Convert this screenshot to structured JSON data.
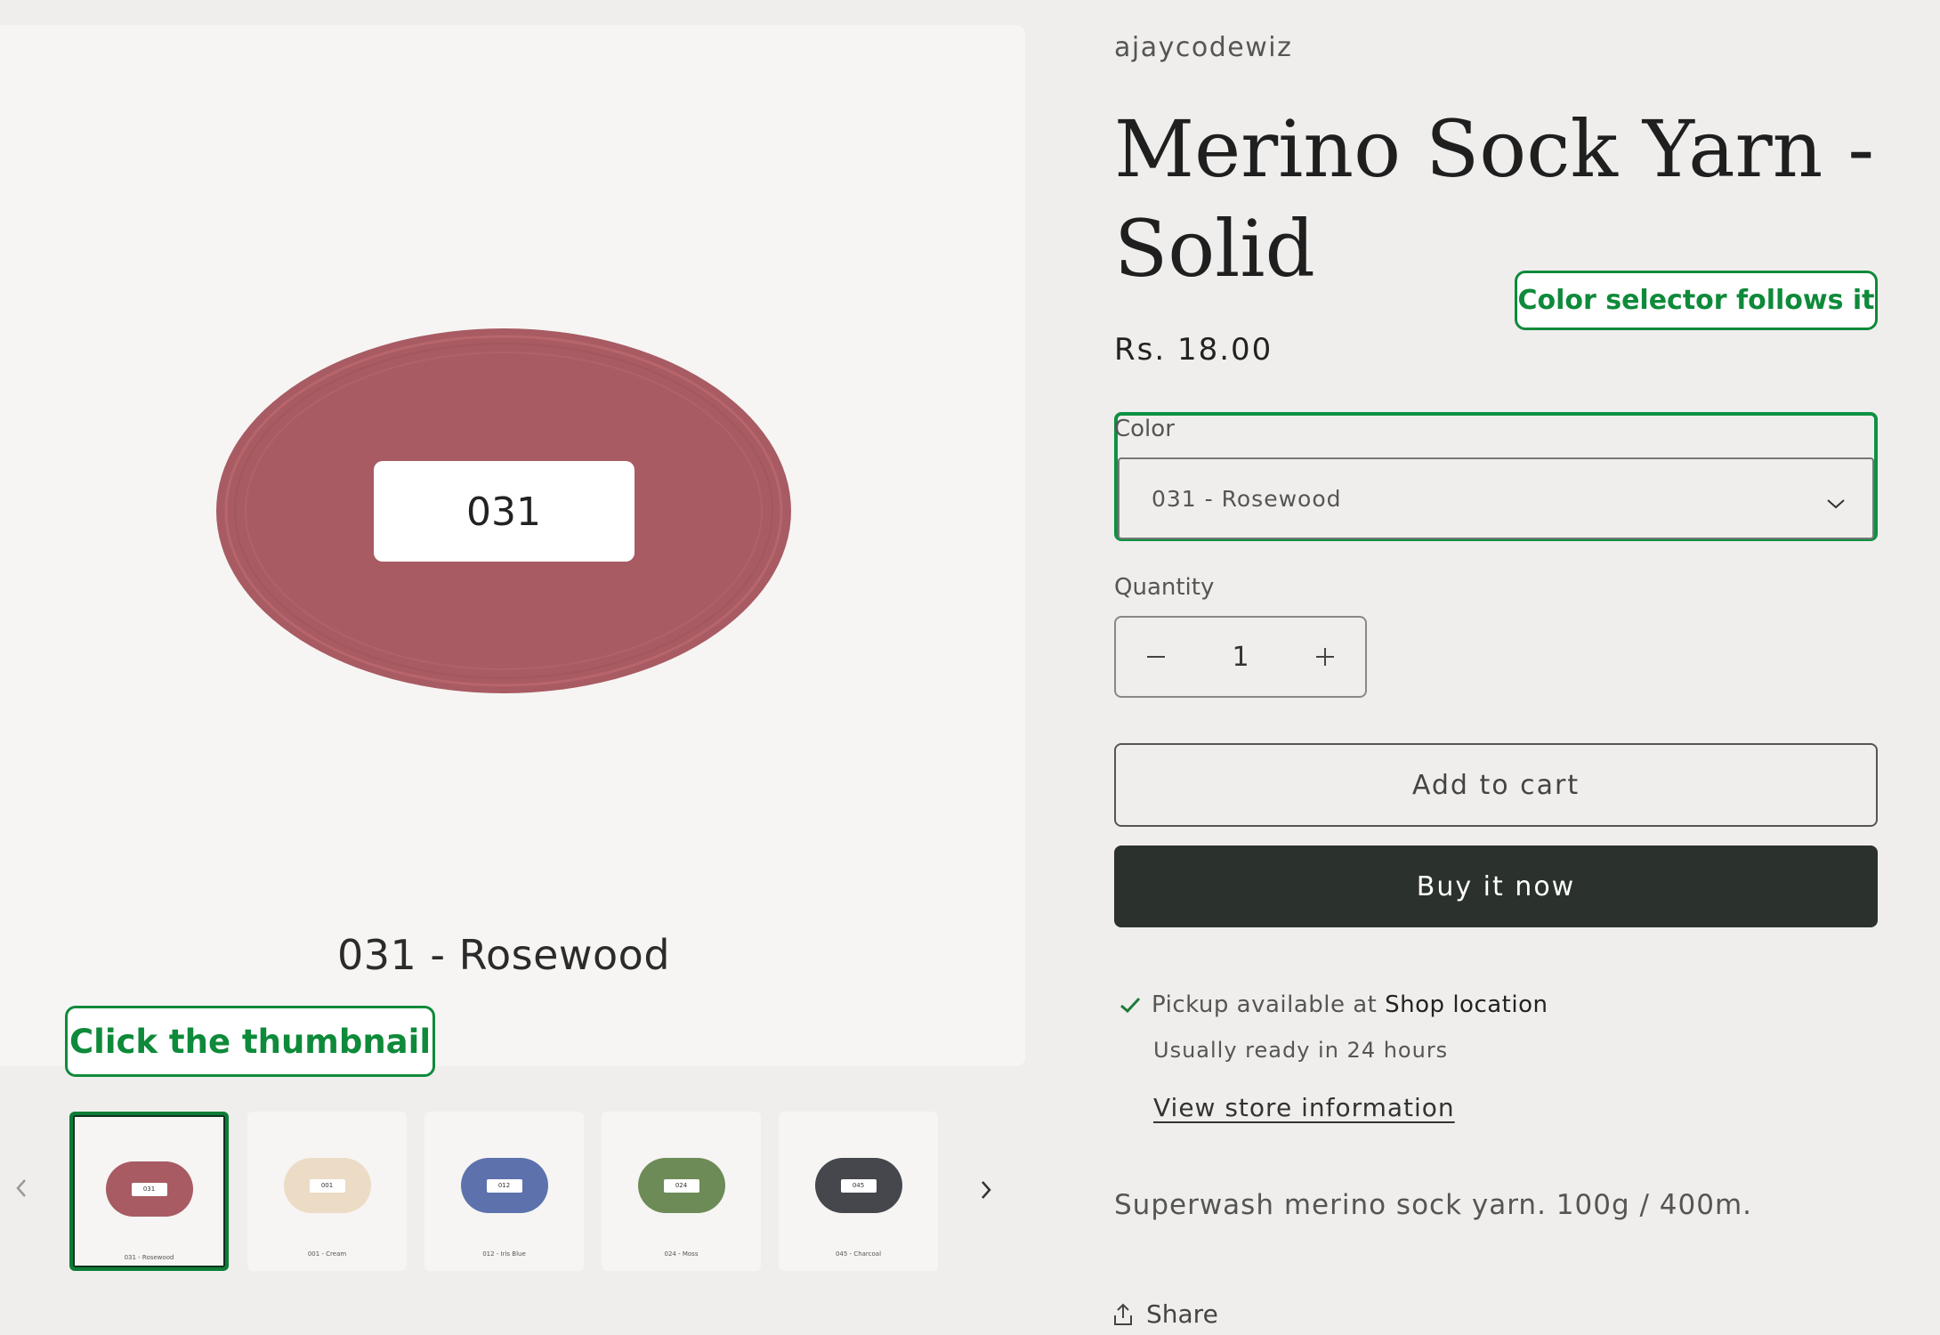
{
  "media": {
    "main_chip": "031",
    "main_caption": "031 - Rosewood",
    "main_color": "#a85b62",
    "thumbnails": [
      {
        "chip": "031",
        "label": "031 - Rosewood",
        "color": "#a85b62",
        "selected": true
      },
      {
        "chip": "001",
        "label": "001 - Cream",
        "color": "#ecdcc6",
        "selected": false
      },
      {
        "chip": "012",
        "label": "012 - Iris Blue",
        "color": "#5d72ad",
        "selected": false
      },
      {
        "chip": "024",
        "label": "024 - Moss",
        "color": "#6d8b57",
        "selected": false
      },
      {
        "chip": "045",
        "label": "045 - Charcoal",
        "color": "#45474d",
        "selected": false
      }
    ],
    "prev_icon": "chevron-left-icon",
    "next_icon": "chevron-right-icon"
  },
  "annotations": {
    "thumbnail_hint": "Click the thumbnail",
    "color_hint": "Color selector follows it"
  },
  "product": {
    "vendor": "ajaycodewiz",
    "title": "Merino Sock Yarn - Solid",
    "price": "Rs. 18.00",
    "color_label": "Color",
    "color_value": "031 - Rosewood",
    "quantity_label": "Quantity",
    "quantity_value": "1",
    "add_to_cart": "Add to cart",
    "buy_now": "Buy it now",
    "pickup_prefix": "Pickup available at ",
    "pickup_location": "Shop location",
    "ready_text": "Usually ready in 24 hours",
    "store_link": "View store information",
    "description": "Superwash merino sock yarn. 100g / 400m.",
    "share": "Share"
  },
  "colors": {
    "accent_green": "#0e8a3a",
    "buy_button_bg": "#2b312d",
    "page_bg": "#efeeec"
  }
}
